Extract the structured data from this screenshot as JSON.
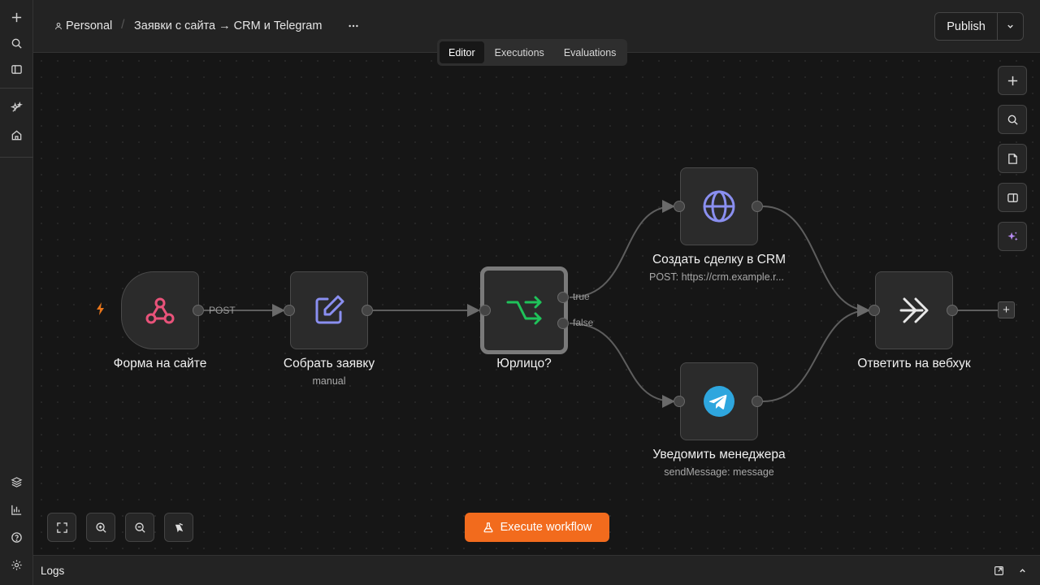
{
  "header": {
    "project": "Personal",
    "workflow_name": "Заявки с сайта → CRM и Telegram",
    "tabs": [
      {
        "label": "Editor",
        "active": true
      },
      {
        "label": "Executions",
        "active": false
      },
      {
        "label": "Evaluations",
        "active": false
      }
    ],
    "publish_label": "Publish"
  },
  "nodes": {
    "webhook": {
      "title": "Форма на сайте",
      "icon": "webhook-icon",
      "edge_label": "POST"
    },
    "set": {
      "title": "Собрать заявку",
      "subtitle": "manual",
      "icon": "pencil-square-icon"
    },
    "if": {
      "title": "Юрлицо?",
      "icon": "branch-icon",
      "true_label": "true",
      "false_label": "false"
    },
    "http": {
      "title": "Создать сделку в CRM",
      "subtitle": "POST: https://crm.example.r...",
      "icon": "globe-icon"
    },
    "telegram": {
      "title": "Уведомить менеджера",
      "subtitle": "sendMessage: message",
      "icon": "telegram-icon"
    },
    "respond": {
      "title": "Ответить на вебхук",
      "icon": "double-arrow-icon"
    }
  },
  "execute_label": "Execute workflow",
  "logs": {
    "title": "Logs"
  },
  "colors": {
    "accent": "#f26b1d",
    "webhook": "#e9537a",
    "set": "#8a8ff0",
    "if": "#1fc25a",
    "http": "#8a8ff0",
    "telegram": "#2ea6de",
    "ai_sparkle": "#b98cf5"
  }
}
